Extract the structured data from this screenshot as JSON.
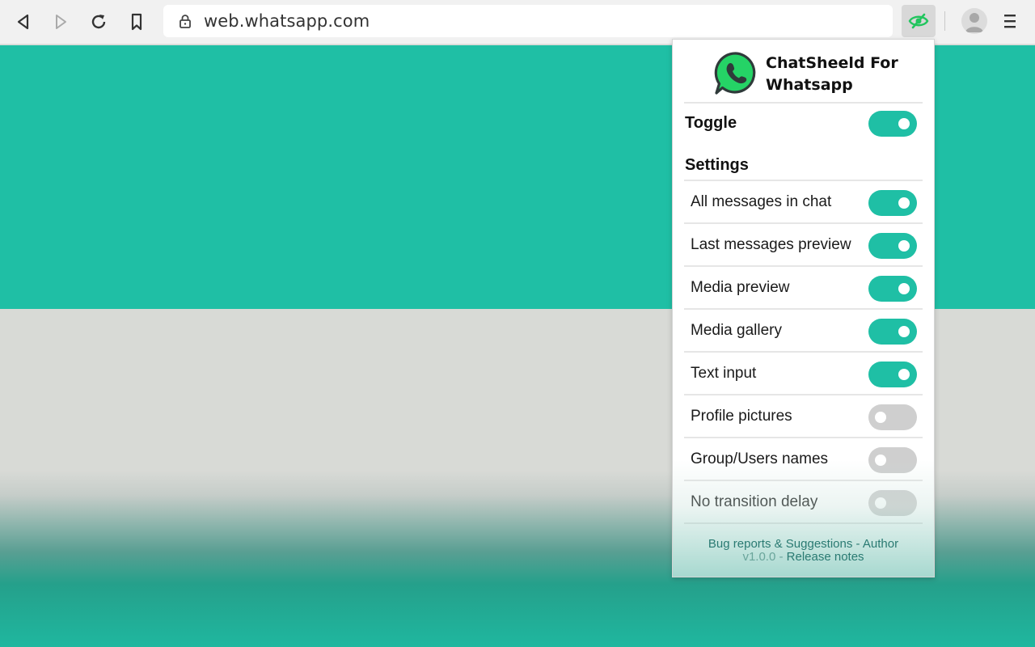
{
  "browser": {
    "url": "web.whatsapp.com",
    "icons": {
      "back": "back-arrow-icon",
      "forward": "forward-arrow-icon",
      "reload": "reload-icon",
      "bookmark": "bookmark-icon",
      "lock": "lock-icon",
      "extension": "eye-slash-icon",
      "profile": "avatar-icon",
      "menu": "menu-icon"
    }
  },
  "popup": {
    "brand_line1": "ChatSheeld For",
    "brand_line2": "Whatsapp",
    "toggle_label": "Toggle",
    "toggle_on": true,
    "settings_label": "Settings",
    "settings": [
      {
        "label": "All messages in chat",
        "on": true
      },
      {
        "label": "Last messages preview",
        "on": true
      },
      {
        "label": "Media preview",
        "on": true
      },
      {
        "label": "Media gallery",
        "on": true
      },
      {
        "label": "Text input",
        "on": true
      },
      {
        "label": "Profile pictures",
        "on": false
      },
      {
        "label": "Group/Users names",
        "on": false
      },
      {
        "label": "No transition delay",
        "on": false
      }
    ],
    "footer": {
      "bug_reports": "Bug reports & Suggestions",
      "sep1": " - ",
      "author": "Author",
      "version": "v1.0.0",
      "sep2": " - ",
      "release_notes": "Release notes"
    }
  },
  "colors": {
    "accent": "#1fbfa5",
    "switch_off": "#cfcfcf",
    "whatsapp_green": "#25d366"
  }
}
